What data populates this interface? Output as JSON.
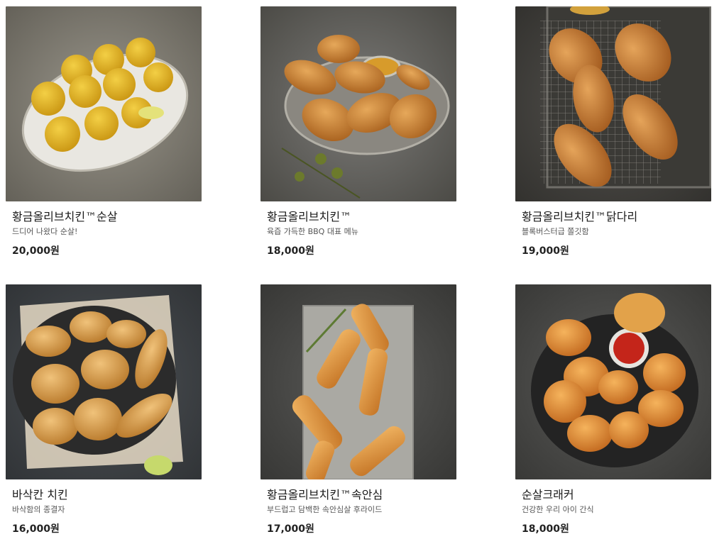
{
  "menu": {
    "items": [
      {
        "name": "황금올리브치킨™순살",
        "description": "드디어 나왔다 순살!",
        "price": "20,000원",
        "image": "boneless-fried-chicken-image"
      },
      {
        "name": "황금올리브치킨™",
        "description": "육즙 가득한 BBQ 대표 메뉴",
        "price": "18,000원",
        "image": "fried-chicken-platter-image"
      },
      {
        "name": "황금올리브치킨™닭다리",
        "description": "블록버스터급 쫄깃함",
        "price": "19,000원",
        "image": "fried-drumsticks-rack-image"
      },
      {
        "name": "바삭칸 치킨",
        "description": "바삭함의 종결자",
        "price": "16,000원",
        "image": "crispy-chicken-plate-image"
      },
      {
        "name": "황금올리브치킨™속안심",
        "description": "부드럽고 담백한 속안심살 후라이드",
        "price": "17,000원",
        "image": "chicken-tenders-board-image"
      },
      {
        "name": "순살크래커",
        "description": "건강한 우리 아이 간식",
        "price": "18,000원",
        "image": "chicken-nuggets-dip-image"
      }
    ]
  }
}
